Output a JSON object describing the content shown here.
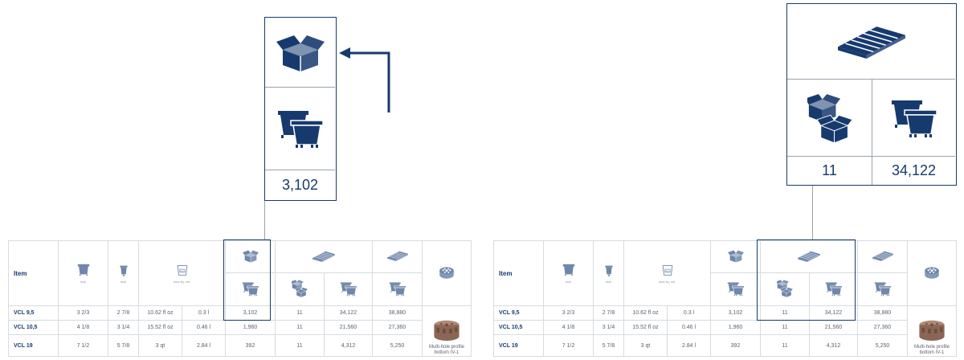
{
  "left": {
    "callout": {
      "value": "3,102",
      "icons": [
        "carton-open-icon",
        "pots-stack-icon"
      ]
    },
    "table": {
      "header": {
        "item": "Item",
        "inch1": "inch",
        "inch2": "inch",
        "vol": "max liq. vol."
      },
      "rows": [
        {
          "name": "VCL 9,5",
          "c1": "3 2/3",
          "c2": "2 7/8",
          "c3": "10.62 fl oz",
          "c4": "0.3 l",
          "c5": "3,102",
          "c6": "11",
          "c7": "34,122",
          "c8": "38,880"
        },
        {
          "name": "VCL 10,5",
          "c1": "4 1/8",
          "c2": "3 1/4",
          "c3": "15.52 fl oz",
          "c4": "0.46 l",
          "c5": "1,960",
          "c6": "11",
          "c7": "21,560",
          "c8": "27,360"
        },
        {
          "name": "VCL 19",
          "c1": "7 1/2",
          "c2": "5 7/8",
          "c3": "3 qt",
          "c4": "2.84 l",
          "c5": "392",
          "c6": "11",
          "c7": "4,312",
          "c8": "5,250"
        }
      ],
      "caption": "Multi-hole profile bottom IV-1"
    }
  },
  "right": {
    "callout": {
      "cartons": "11",
      "pots": "34,122",
      "icons": [
        "pallet-icon",
        "cartons-stack-icon",
        "pots-stack-icon"
      ]
    },
    "table": {
      "header": {
        "item": "Item",
        "inch1": "inch",
        "inch2": "inch",
        "vol": "max liq. vol."
      },
      "rows": [
        {
          "name": "VCL 9,5",
          "c1": "3 2/3",
          "c2": "2 7/8",
          "c3": "10.62 fl oz",
          "c4": "0.3 l",
          "c5": "3,102",
          "c6": "11",
          "c7": "34,122",
          "c8": "38,880"
        },
        {
          "name": "VCL 10,5",
          "c1": "4 1/8",
          "c2": "3 1/4",
          "c3": "15.52 fl oz",
          "c4": "0.46 l",
          "c5": "1,960",
          "c6": "11",
          "c7": "21,560",
          "c8": "27,360"
        },
        {
          "name": "VCL 19",
          "c1": "7 1/2",
          "c2": "5 7/8",
          "c3": "3 qt",
          "c4": "2.84 l",
          "c5": "392",
          "c6": "11",
          "c7": "4,312",
          "c8": "5,250"
        }
      ],
      "caption": "Multi-hole profile bottom IV-1"
    }
  },
  "colors": {
    "accent": "#173a6e",
    "icon": "#6f87ab",
    "grid": "#d7dbe0",
    "product": "#8b6654"
  }
}
